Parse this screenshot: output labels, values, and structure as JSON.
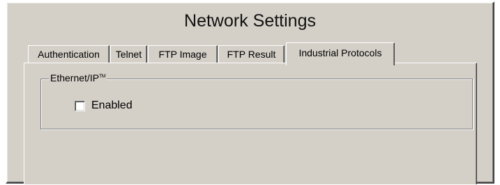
{
  "window": {
    "title": "Network Settings"
  },
  "tabs": [
    {
      "label": "Authentication",
      "active": false
    },
    {
      "label": "Telnet",
      "active": false
    },
    {
      "label": "FTP Image",
      "active": false
    },
    {
      "label": "FTP Result",
      "active": false
    },
    {
      "label": "Industrial Protocols",
      "active": true
    }
  ],
  "panel": {
    "group": {
      "label": "Ethernet/IP",
      "trademark": "TM",
      "enabled_label": "Enabled",
      "enabled_checked": false
    }
  }
}
